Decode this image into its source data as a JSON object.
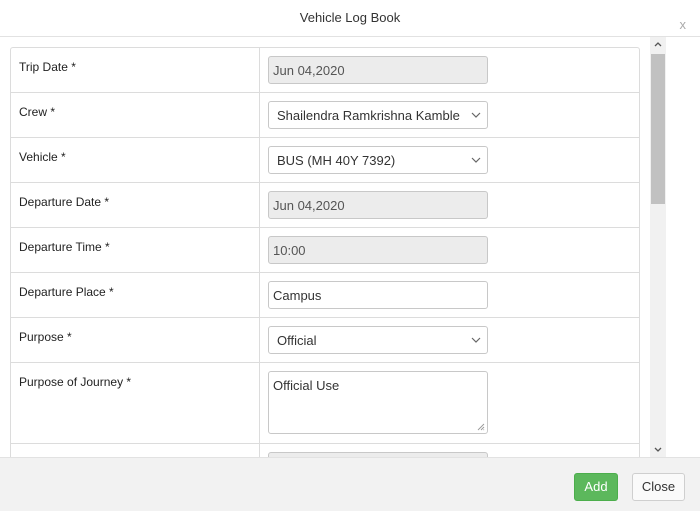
{
  "header": {
    "title": "Vehicle Log Book",
    "close_glyph": "x"
  },
  "form": {
    "trip_date": {
      "label": "Trip Date *",
      "value": "Jun 04,2020"
    },
    "crew": {
      "label": "Crew *",
      "value": "Shailendra Ramkrishna Kamble"
    },
    "vehicle": {
      "label": "Vehicle *",
      "value": "BUS (MH 40Y 7392)"
    },
    "departure_date": {
      "label": "Departure Date *",
      "value": "Jun 04,2020"
    },
    "departure_time": {
      "label": "Departure Time *",
      "value": "10:00"
    },
    "departure_place": {
      "label": "Departure Place *",
      "value": "Campus"
    },
    "purpose": {
      "label": "Purpose *",
      "value": "Official"
    },
    "purpose_of_journey": {
      "label": "Purpose of Journey *",
      "value": "Official Use"
    }
  },
  "footer": {
    "add_label": "Add",
    "close_label": "Close"
  },
  "icons": {
    "select": "chevron-down-icon",
    "scroll_up": "chevron-up-icon",
    "scroll_down": "chevron-down-icon",
    "resize": "resize-handle-icon"
  },
  "colors": {
    "add_button": "#5cb85c",
    "readonly_field": "#ececec",
    "footer_bg": "#f2f2f2"
  }
}
